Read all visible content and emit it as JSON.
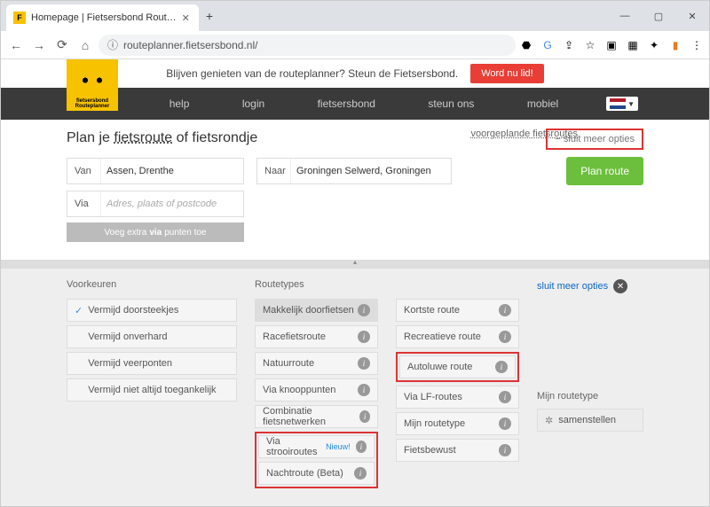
{
  "browser": {
    "tab_title": "Homepage | Fietsersbond Rout…",
    "url": "routeplanner.fietsersbond.nl/",
    "win": {
      "min": "—",
      "max": "▢",
      "close": "✕"
    }
  },
  "topbar": {
    "msg": "Blijven genieten van de routeplanner? Steun de Fietsersbond.",
    "cta": "Word nu lid!"
  },
  "logo": {
    "line1": "fietsersbond",
    "line2": "Routeplanner"
  },
  "nav": [
    "help",
    "login",
    "fietsersbond",
    "steun ons",
    "mobiel"
  ],
  "planner": {
    "title_prefix": "Plan je ",
    "title_ul": "fietsroute",
    "title_rest": " of fietsrondje",
    "sluit": "− sluit meer opties",
    "voorgepland": "voorgeplande fietsroutes",
    "van": {
      "label": "Van",
      "value": "Assen, Drenthe"
    },
    "naar": {
      "label": "Naar",
      "value": "Groningen Selwerd, Groningen"
    },
    "via": {
      "label": "Via",
      "placeholder": "Adres, plaats of postcode"
    },
    "extra_via_l": "Voeg extra ",
    "extra_via_b": "via",
    "extra_via_r": " punten toe",
    "plan_btn": "Plan route"
  },
  "options_header": {
    "voorkeuren": "Voorkeuren",
    "routetypes": "Routetypes",
    "sluit_meer": "sluit meer opties"
  },
  "voorkeuren": [
    {
      "label": "Vermijd doorsteekjes",
      "checked": true
    },
    {
      "label": "Vermijd onverhard",
      "checked": false
    },
    {
      "label": "Vermijd veerponten",
      "checked": false
    },
    {
      "label": "Vermijd niet altijd toegankelijk",
      "checked": false
    }
  ],
  "routetypes_col1": [
    {
      "label": "Makkelijk doorfietsen",
      "selected": true
    },
    {
      "label": "Racefietsroute"
    },
    {
      "label": "Natuurroute"
    },
    {
      "label": "Via knooppunten"
    },
    {
      "label": "Combinatie fietsnetwerken"
    },
    {
      "label": "Via strooiroutes",
      "new": "Nieuw!"
    },
    {
      "label": "Nachtroute (Beta)"
    }
  ],
  "routetypes_col2": [
    {
      "label": "Kortste route"
    },
    {
      "label": "Recreatieve route"
    },
    {
      "label": "Autoluwe route"
    },
    {
      "label": "Via LF-routes"
    },
    {
      "label": "Mijn routetype"
    },
    {
      "label": "Fietsbewust"
    }
  ],
  "side": {
    "mijn": "Mijn routetype",
    "samen": "samenstellen"
  }
}
